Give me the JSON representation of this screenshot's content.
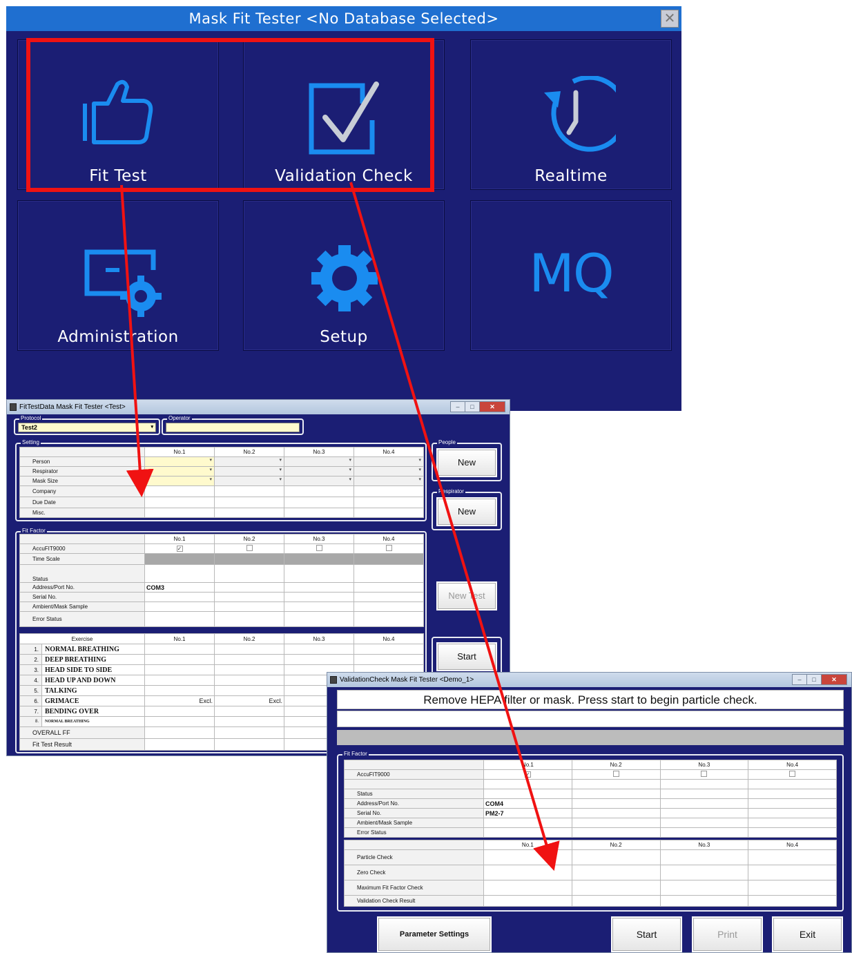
{
  "main_window": {
    "title": "Mask Fit Tester <No Database Selected>",
    "close_icon": "close-x",
    "tiles": [
      {
        "label": "Fit Test",
        "icon": "thumbs-up-icon"
      },
      {
        "label": "Validation Check",
        "icon": "checkbox-icon"
      },
      {
        "label": "Realtime",
        "icon": "clock-icon"
      },
      {
        "label": "Administration",
        "icon": "admin-settings-icon"
      },
      {
        "label": "Setup",
        "icon": "gear-icon"
      },
      {
        "label": "MQ",
        "icon": "mq-logo"
      }
    ],
    "colors": {
      "background": "#1b1e74",
      "title_bar": "#1f6fd0",
      "icon_blue": "#1a8cf0"
    }
  },
  "fit_window": {
    "title": "FitTestData Mask Fit Tester <Test>",
    "protocol_label": "Protocol",
    "protocol_value": "Test2",
    "operator_label": "Operator",
    "operator_value": "",
    "setting_label": "Setting",
    "columns": [
      "No.1",
      "No.2",
      "No.3",
      "No.4"
    ],
    "setting_rows": [
      "Person",
      "Respirator",
      "Mask Size",
      "Company",
      "Due Date",
      "Misc."
    ],
    "fit_factor_label": "Fit Factor",
    "ff_rows": {
      "accufit": "AccuFIT9000",
      "time_scale": "Time Scale",
      "status": "Status",
      "address": "Address/Port No.",
      "address_value": "COM3",
      "serial": "Serial No.",
      "ambient": "Ambient/Mask Sample",
      "error": "Error Status"
    },
    "exercise_header": "Exercise",
    "exercises": [
      {
        "num": "1.",
        "name": "NORMAL BREATHING",
        "no1": "",
        "no2": ""
      },
      {
        "num": "2.",
        "name": "DEEP BREATHING",
        "no1": "",
        "no2": ""
      },
      {
        "num": "3.",
        "name": "HEAD SIDE TO SIDE",
        "no1": "",
        "no2": ""
      },
      {
        "num": "4.",
        "name": "HEAD UP AND DOWN",
        "no1": "",
        "no2": ""
      },
      {
        "num": "5.",
        "name": "TALKING",
        "no1": "",
        "no2": ""
      },
      {
        "num": "6.",
        "name": "GRIMACE",
        "no1": "Excl.",
        "no2": "Excl."
      },
      {
        "num": "7.",
        "name": "BENDING OVER",
        "no1": "",
        "no2": ""
      },
      {
        "num": "8.",
        "name": "NORMAL BREATHING",
        "no1": "",
        "no2": ""
      }
    ],
    "overall_ff": "OVERALL FF",
    "fit_test_result": "Fit Test Result",
    "people_label": "People",
    "respirator_label": "Respirator",
    "new_label": "New",
    "new_test_label": "New Test",
    "start_label": "Start"
  },
  "validation_window": {
    "title": "ValidationCheck Mask Fit Tester <Demo_1>",
    "message": "Remove HEPA filter or mask. Press start to begin particle check.",
    "fit_factor_label": "Fit Factor",
    "columns": [
      "No.1",
      "No.2",
      "No.3",
      "No.4"
    ],
    "accufit": "AccuFIT9000",
    "status": "Status",
    "address": "Address/Port No.",
    "address_value": "COM4",
    "serial": "Serial No.",
    "serial_value": "PM2-7",
    "ambient": "Ambient/Mask Sample",
    "error": "Error Status",
    "particle_check": "Particle Check",
    "zero_check": "Zero Check",
    "max_ff_check": "Maximum Fit Factor Check",
    "validation_result": "Validation Check Result",
    "buttons": {
      "parameter_settings": "Parameter Settings",
      "start": "Start",
      "print": "Print",
      "exit": "Exit"
    }
  },
  "annotation_color": "#f01212"
}
